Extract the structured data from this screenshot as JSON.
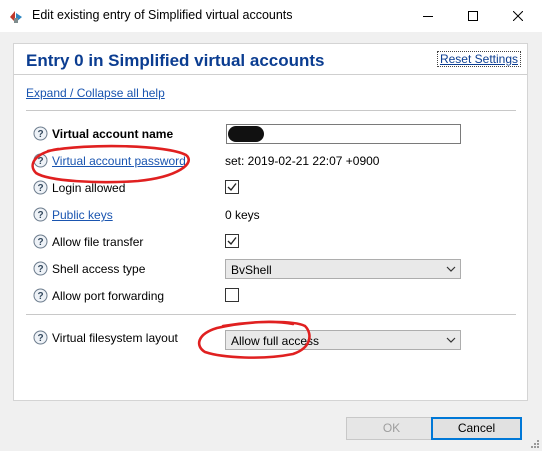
{
  "window": {
    "title": "Edit existing entry of Simplified virtual accounts"
  },
  "header": {
    "title": "Entry 0 in Simplified virtual accounts",
    "reset_label": "Reset Settings"
  },
  "expand_label": "Expand / Collapse all help",
  "fields": {
    "account_name": {
      "label": "Virtual account name"
    },
    "password": {
      "label": "Virtual account password",
      "value": "set:  2019-02-21 22:07 +0900"
    },
    "login_allowed": {
      "label": "Login allowed",
      "checked": true
    },
    "public_keys": {
      "label": "Public keys",
      "value": "0 keys"
    },
    "file_transfer": {
      "label": "Allow file transfer",
      "checked": true
    },
    "shell_access": {
      "label": "Shell access type",
      "selected": "BvShell"
    },
    "port_forwarding": {
      "label": "Allow port forwarding",
      "checked": false
    },
    "filesystem_layout": {
      "label": "Virtual filesystem layout",
      "selected": "Allow full access"
    }
  },
  "buttons": {
    "ok_label": "OK",
    "cancel_label": "Cancel"
  },
  "icons": {
    "help": "help-question-icon",
    "app": "bitvise-app-icon"
  },
  "colors": {
    "heading": "#0b3d91",
    "link": "#1a55b0",
    "annotation": "#e02020",
    "focus": "#0078d7"
  }
}
